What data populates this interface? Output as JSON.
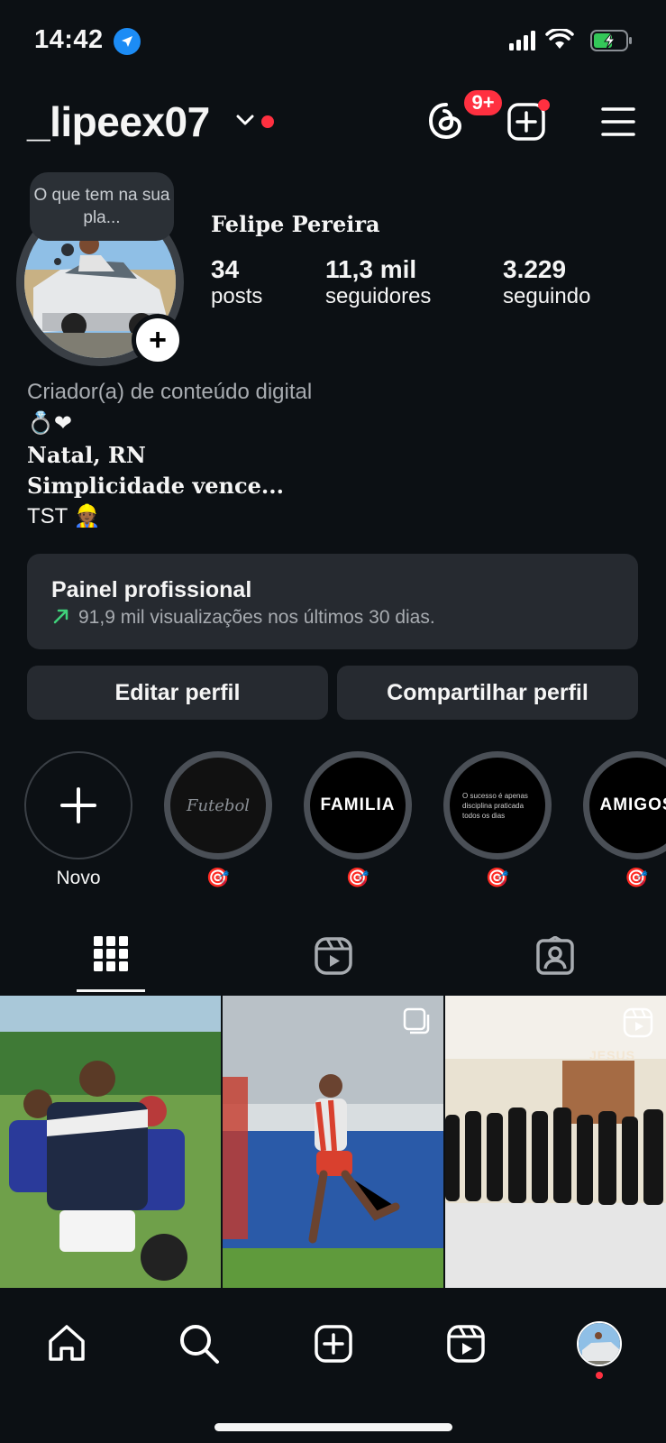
{
  "status_bar": {
    "time": "14:42"
  },
  "header": {
    "username": "_lipeex07",
    "threads_badge": "9+"
  },
  "profile": {
    "note": "O que tem na sua pla...",
    "display_name": "Felipe Pereira",
    "stats": [
      {
        "value": "34",
        "label": "posts"
      },
      {
        "value": "11,3 mil",
        "label": "seguidores"
      },
      {
        "value": "3.229",
        "label": "seguindo"
      }
    ]
  },
  "bio": {
    "category": "Criador(a) de conteúdo digital",
    "line1": "💍❤",
    "line2": "Natal, RN",
    "line3": "Simplicidade vence...",
    "line4": "TST 👷🏾"
  },
  "professional_panel": {
    "title": "Painel profissional",
    "subtitle": "91,9 mil visualizações nos últimos 30 dias."
  },
  "buttons": {
    "edit": "Editar perfil",
    "share": "Compartilhar perfil"
  },
  "highlights": [
    {
      "label": "Novo",
      "cover_text": ""
    },
    {
      "label": "🎯",
      "cover_text": "Futebol"
    },
    {
      "label": "🎯",
      "cover_text": "FAMILIA"
    },
    {
      "label": "🎯",
      "cover_text": "O sucesso é apenas disciplina praticada todos os dias"
    },
    {
      "label": "🎯",
      "cover_text": "AMIGOS"
    }
  ],
  "posts": [
    {
      "type": "photo"
    },
    {
      "type": "carousel"
    },
    {
      "type": "reel",
      "sign_text": "JESUS"
    }
  ],
  "tabs": [
    "grid-icon",
    "reels-icon",
    "tagged-icon"
  ],
  "colors": {
    "background": "#0c1014",
    "surface": "#262a30",
    "notification_red": "#ff3040",
    "location_blue": "#1c8cf5",
    "trend_green": "#3fd17a"
  }
}
